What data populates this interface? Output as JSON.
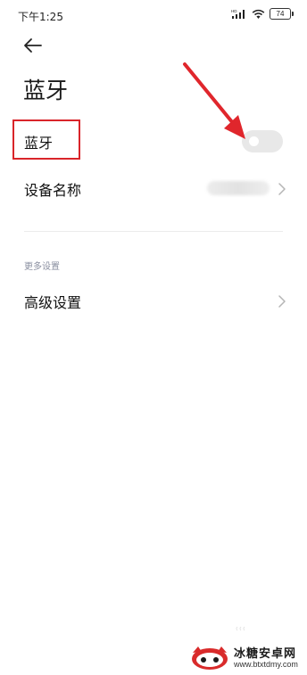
{
  "status_bar": {
    "time": "下午1:25",
    "network_label": "HD",
    "battery_level": "74",
    "icons": [
      "signal-icon",
      "wifi-icon",
      "battery-icon"
    ]
  },
  "header": {
    "back_icon": "back-arrow-icon",
    "title": "蓝牙"
  },
  "bluetooth_row": {
    "label": "蓝牙",
    "toggle_on": false
  },
  "device_name_row": {
    "label": "设备名称",
    "value_blurred": true
  },
  "more_settings": {
    "section_label": "更多设置",
    "advanced_label": "高级设置"
  },
  "watermark": {
    "name": "冰糖安卓网",
    "url": "www.btxtdmy.com"
  },
  "colors": {
    "highlight_border": "#d9252a",
    "annotation_arrow": "#e0262c",
    "toggle_off": "#e8e8e8",
    "section_text": "#8a8fa0"
  }
}
